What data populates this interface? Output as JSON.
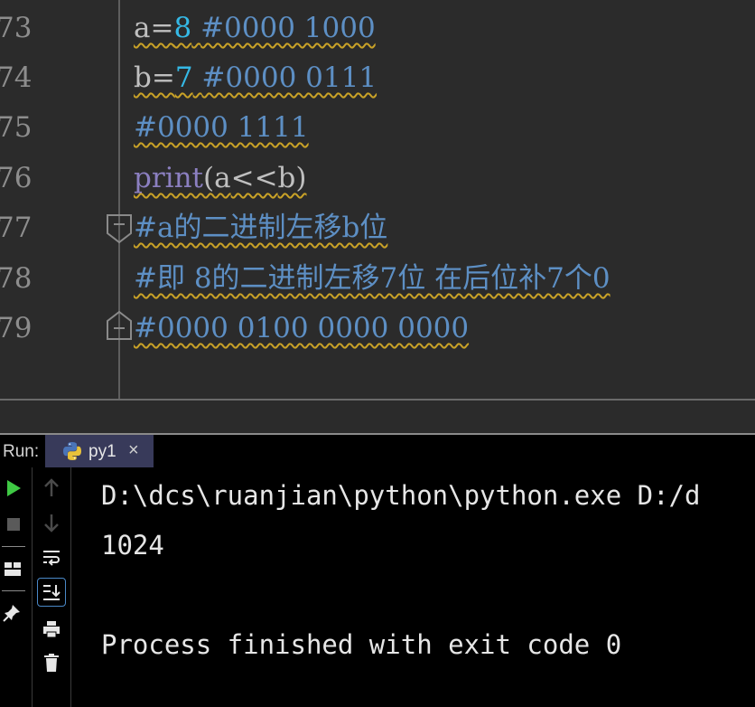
{
  "editor": {
    "lines": [
      {
        "num": "73",
        "parts": [
          {
            "text": "a=",
            "cls": "c-ident"
          },
          {
            "text": "8",
            "cls": "c-num"
          },
          {
            "text": " ",
            "cls": "c-ident"
          },
          {
            "text": "#0000 1000",
            "cls": "c-comment"
          }
        ]
      },
      {
        "num": "74",
        "parts": [
          {
            "text": "b=",
            "cls": "c-ident"
          },
          {
            "text": "7",
            "cls": "c-num"
          },
          {
            "text": " ",
            "cls": "c-ident"
          },
          {
            "text": "#0000 0111",
            "cls": "c-comment"
          }
        ]
      },
      {
        "num": "75",
        "parts": [
          {
            "text": "#0000 1111",
            "cls": "c-comment"
          }
        ]
      },
      {
        "num": "76",
        "parts": [
          {
            "text": "print",
            "cls": "c-print"
          },
          {
            "text": "(a",
            "cls": "c-ident"
          },
          {
            "text": "<<",
            "cls": "c-ident"
          },
          {
            "text": "b)",
            "cls": "c-ident"
          }
        ]
      },
      {
        "num": "77",
        "parts": [
          {
            "text": "#a的二进制左移b位",
            "cls": "c-comment"
          }
        ]
      },
      {
        "num": "78",
        "parts": [
          {
            "text": "#即 8的二进制左移7位 在后位补7个0",
            "cls": "c-comment"
          }
        ]
      },
      {
        "num": "79",
        "parts": [
          {
            "text": "#0000 0100 0000 0000",
            "cls": "c-comment"
          }
        ]
      }
    ]
  },
  "run": {
    "label": "Run:",
    "tab_name": "py1",
    "tab_close": "×",
    "icons": [
      "python-icon",
      "close-icon"
    ]
  },
  "toolbar": {
    "icons": [
      "run-icon",
      "stop-icon",
      "layout-icon",
      "pin-icon",
      "up-arrow-icon",
      "down-arrow-icon",
      "soft-wrap-icon",
      "scroll-to-end-icon",
      "print-icon",
      "trash-icon"
    ]
  },
  "console": {
    "line1": "D:\\dcs\\ruanjian\\python\\python.exe D:/d",
    "line2": "1024",
    "line3": "",
    "line4": "Process finished with exit code 0"
  },
  "colors": {
    "editor_bg": "#2b2b2b",
    "number": "#35b9e6",
    "comment": "#5d8fc4",
    "builtin": "#8b7fc0",
    "wavy_underline": "#c9a227",
    "run_green": "#3fc944"
  }
}
